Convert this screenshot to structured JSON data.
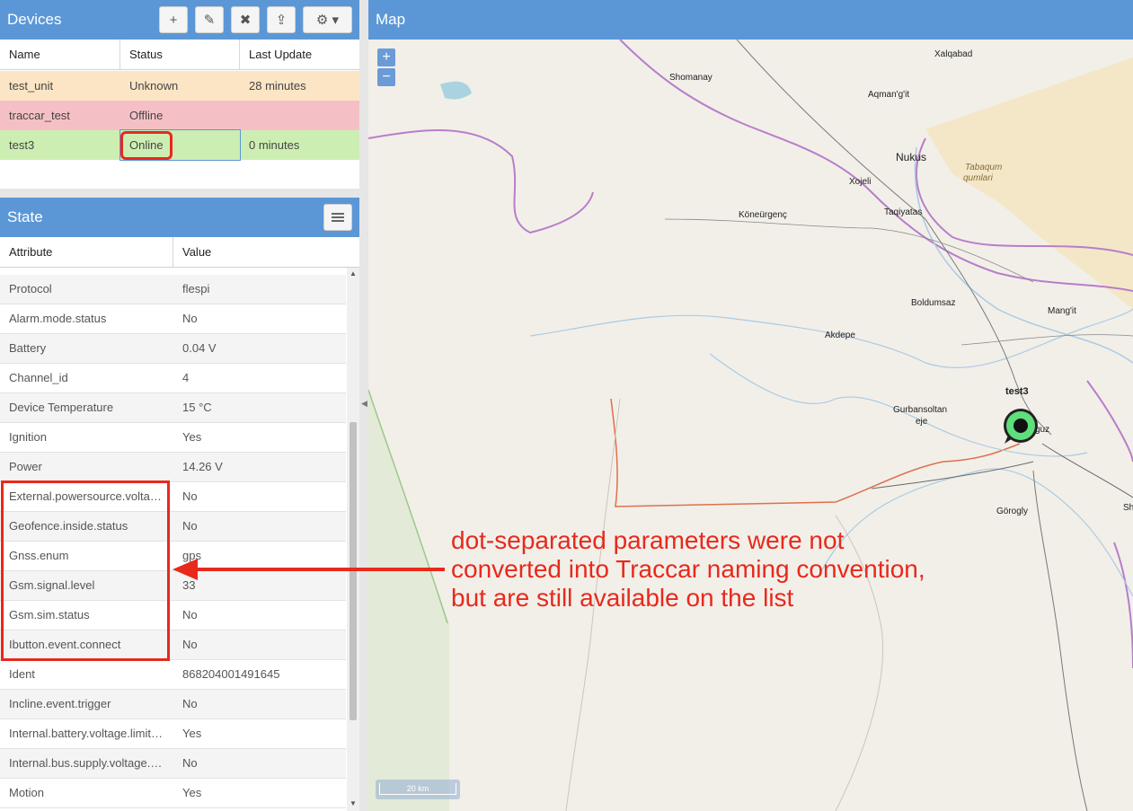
{
  "devices": {
    "title": "Devices",
    "toolbar": [
      {
        "icon": "plus-icon",
        "glyph": "+"
      },
      {
        "icon": "pencil-icon",
        "glyph": "✎"
      },
      {
        "icon": "close-icon",
        "glyph": "✖"
      },
      {
        "icon": "upload-icon",
        "glyph": "⇪"
      },
      {
        "icon": "gear-icon",
        "glyph": "⚙ ▾"
      }
    ],
    "columns": [
      "Name",
      "Status",
      "Last Update"
    ],
    "rows": [
      {
        "name": "test_unit",
        "status": "Unknown",
        "last_update": "28 minutes",
        "color": "#fbe5c4"
      },
      {
        "name": "traccar_test",
        "status": "Offline",
        "last_update": "",
        "color": "#f4c0c6"
      },
      {
        "name": "test3",
        "status": "Online",
        "last_update": "0 minutes",
        "color": "#cdeeb3"
      }
    ]
  },
  "state": {
    "title": "State",
    "menu_icon": "list-icon",
    "columns": [
      "Attribute",
      "Value"
    ],
    "rows": [
      {
        "attribute": "Protocol",
        "value": "flespi"
      },
      {
        "attribute": "Alarm.mode.status",
        "value": "No"
      },
      {
        "attribute": "Battery",
        "value": "0.04 V"
      },
      {
        "attribute": "Channel_id",
        "value": "4"
      },
      {
        "attribute": "Device Temperature",
        "value": "15 °C"
      },
      {
        "attribute": "Ignition",
        "value": "Yes"
      },
      {
        "attribute": "Power",
        "value": "14.26 V"
      },
      {
        "attribute": "External.powersource.voltage.range.outside.status",
        "value": "No"
      },
      {
        "attribute": "Geofence.inside.status",
        "value": "No"
      },
      {
        "attribute": "Gnss.enum",
        "value": "gps"
      },
      {
        "attribute": "Gsm.signal.level",
        "value": "33"
      },
      {
        "attribute": "Gsm.sim.status",
        "value": "No"
      },
      {
        "attribute": "Ibutton.event.connect",
        "value": "No"
      },
      {
        "attribute": "Ident",
        "value": "868204001491645"
      },
      {
        "attribute": "Incline.event.trigger",
        "value": "No"
      },
      {
        "attribute": "Internal.battery.voltage.limit.lower.status",
        "value": "Yes"
      },
      {
        "attribute": "Internal.bus.supply.voltage.range.outside.status",
        "value": "No"
      },
      {
        "attribute": "Motion",
        "value": "Yes"
      }
    ]
  },
  "map": {
    "title": "Map",
    "zoom_in": "+",
    "zoom_out": "−",
    "scale": "20 km",
    "marker_label": "test3",
    "places": [
      {
        "name": "Xalqabad"
      },
      {
        "name": "Shomanay"
      },
      {
        "name": "Aqman'g'it"
      },
      {
        "name": "Nukus"
      },
      {
        "name": "Xojeli"
      },
      {
        "name": "Tabaqum"
      },
      {
        "name": "qumlari"
      },
      {
        "name": "Taqiyatas"
      },
      {
        "name": "Köneürgenç"
      },
      {
        "name": "Boldumsaz"
      },
      {
        "name": "Mang'it"
      },
      {
        "name": "Akdepe"
      },
      {
        "name": "Gurbansoltan"
      },
      {
        "name": "eje"
      },
      {
        "name": "guz"
      },
      {
        "name": "Görogly"
      },
      {
        "name": "Sh"
      }
    ]
  },
  "annotation": {
    "lines": [
      "dot-separated parameters were not",
      "converted into Traccar naming convention,",
      "but are still available on the list"
    ],
    "color": "#e8291c"
  }
}
